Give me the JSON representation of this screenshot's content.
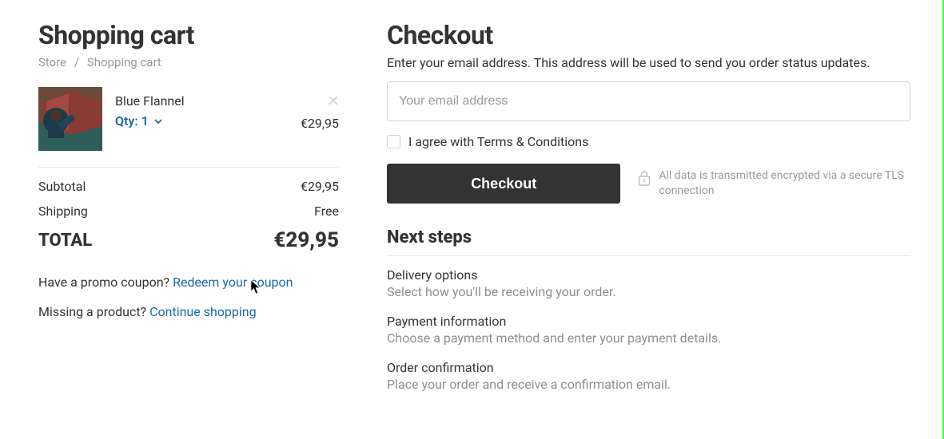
{
  "cart": {
    "title": "Shopping cart",
    "crumb_store": "Store",
    "crumb_sep": "/",
    "crumb_current": "Shopping cart",
    "item": {
      "name": "Blue Flannel",
      "qty_label": "Qty: 1",
      "price": "€29,95"
    },
    "subtotal_label": "Subtotal",
    "subtotal_value": "€29,95",
    "shipping_label": "Shipping",
    "shipping_value": "Free",
    "total_label": "TOTAL",
    "total_value": "€29,95",
    "promo_q": "Have a promo coupon? ",
    "promo_link": "Redeem your coupon",
    "missing_q": "Missing a product? ",
    "continue_link": "Continue shopping"
  },
  "checkout": {
    "title": "Checkout",
    "subtitle": "Enter your email address. This address will be used to send you order status updates.",
    "email_placeholder": "Your email address",
    "agree_label": "I agree with Terms & Conditions",
    "button": "Checkout",
    "security_note": "All data is transmitted encrypted via a secure TLS connection",
    "next_title": "Next steps",
    "steps": {
      "delivery_t": "Delivery options",
      "delivery_d": "Select how you'll be receiving your order.",
      "payment_t": "Payment information",
      "payment_d": "Choose a payment method and enter your payment details.",
      "confirm_t": "Order confirmation",
      "confirm_d": "Place your order and receive a confirmation email."
    }
  }
}
